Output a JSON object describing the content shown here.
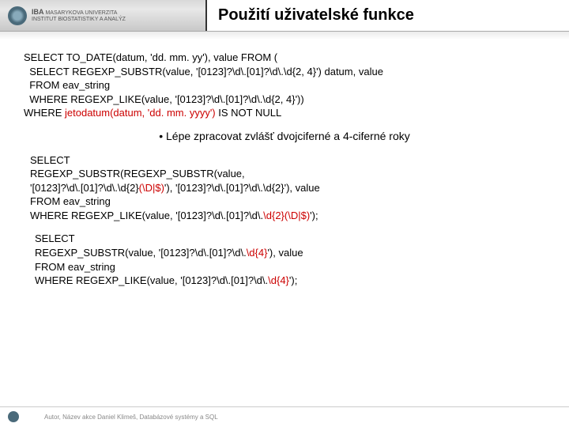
{
  "header": {
    "logo_line1": "MASARYKOVA UNIVERZITA",
    "logo_line2": "INSTITUT BIOSTATISTIKY A ANALÝZ",
    "iba": "IBA",
    "title": "Použití uživatelské funkce"
  },
  "code1": {
    "l1a": "SELECT TO_DATE(datum, 'dd. mm. yy'), value FROM (",
    "l2a": "  SELECT REGEXP_SUBSTR(value, '[0123]?\\d\\.[01]?\\d\\.\\d{2, 4}') datum, value",
    "l3a": "  FROM eav_string",
    "l4a": "  WHERE REGEXP_LIKE(value, '[0123]?\\d\\.[01]?\\d\\.\\d{2, 4}'))",
    "l5a": "WHERE ",
    "l5fn": "jetodatum(datum, 'dd. mm. yyyy')",
    "l5b": " IS NOT NULL"
  },
  "bullet_text": "• Lépe zpracovat zvlášť dvojciferné a 4-ciferné roky",
  "code2": {
    "l1": "SELECT",
    "l2": "REGEXP_SUBSTR(REGEXP_SUBSTR(value,",
    "l3a": "'[0123]?\\d\\.[01]?\\d\\.\\d{2}",
    "l3p": "(\\D|$)",
    "l3b": "'), '[0123]?\\d\\.[01]?\\d\\.\\d{2}'), value",
    "l4": "FROM eav_string",
    "l5a": "WHERE REGEXP_LIKE(value, '[0123]?\\d\\.[01]?\\d\\.",
    "l5p": "\\d{2}(\\D|$)",
    "l5b": "');"
  },
  "code3": {
    "l1": "SELECT",
    "l2a": "REGEXP_SUBSTR(value, '[0123]?\\d\\.[01]?\\d\\.",
    "l2p": "\\d{4}",
    "l2b": "'), value",
    "l3": "FROM eav_string",
    "l4a": "WHERE REGEXP_LIKE(value, '[0123]?\\d\\.[01]?\\d\\.",
    "l4p": "\\d{4}",
    "l4b": "');"
  },
  "footer": {
    "text": "Autor, Název akce   Daniel Klimeš, Databázové systémy a SQL"
  }
}
